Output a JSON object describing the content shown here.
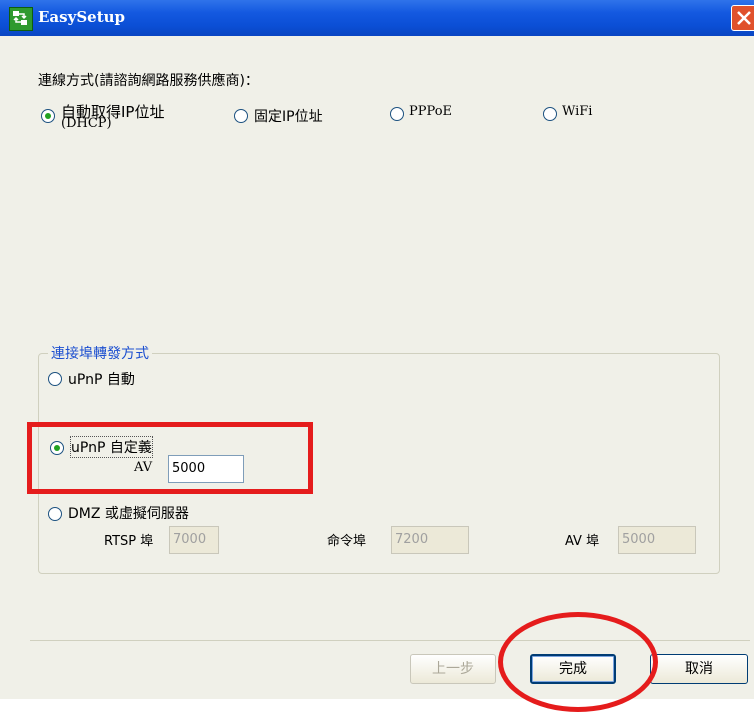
{
  "window": {
    "title": "EasySetup",
    "icon": "network-setup-icon"
  },
  "connection": {
    "heading": "連線方式(請諮詢網路服務供應商)：",
    "options": [
      {
        "label": "自動取得IP位址",
        "sublabel": "(DHCP)",
        "selected": true
      },
      {
        "label": "固定IP位址",
        "selected": false
      },
      {
        "label": "PPPoE",
        "selected": false
      },
      {
        "label": "WiFi",
        "selected": false
      }
    ]
  },
  "forwarding": {
    "legend": "連接埠轉發方式",
    "upnp_auto": {
      "label": "uPnP 自動",
      "selected": false
    },
    "upnp_custom": {
      "label": "uPnP 自定義",
      "selected": true,
      "av_label": "AV",
      "av_value": "5000"
    },
    "dmz": {
      "label": "DMZ 或虛擬伺服器",
      "selected": false,
      "rtsp_label": "RTSP 埠",
      "rtsp_value": "7000",
      "cmd_label": "命令埠",
      "cmd_value": "7200",
      "av_label": "AV 埠",
      "av_value": "5000"
    }
  },
  "buttons": {
    "prev": "上一步",
    "finish": "完成",
    "cancel": "取消"
  },
  "colors": {
    "title_bar": "#0b4fd6",
    "annotation": "#e51c1c",
    "group_legend": "#1c4fd0"
  }
}
